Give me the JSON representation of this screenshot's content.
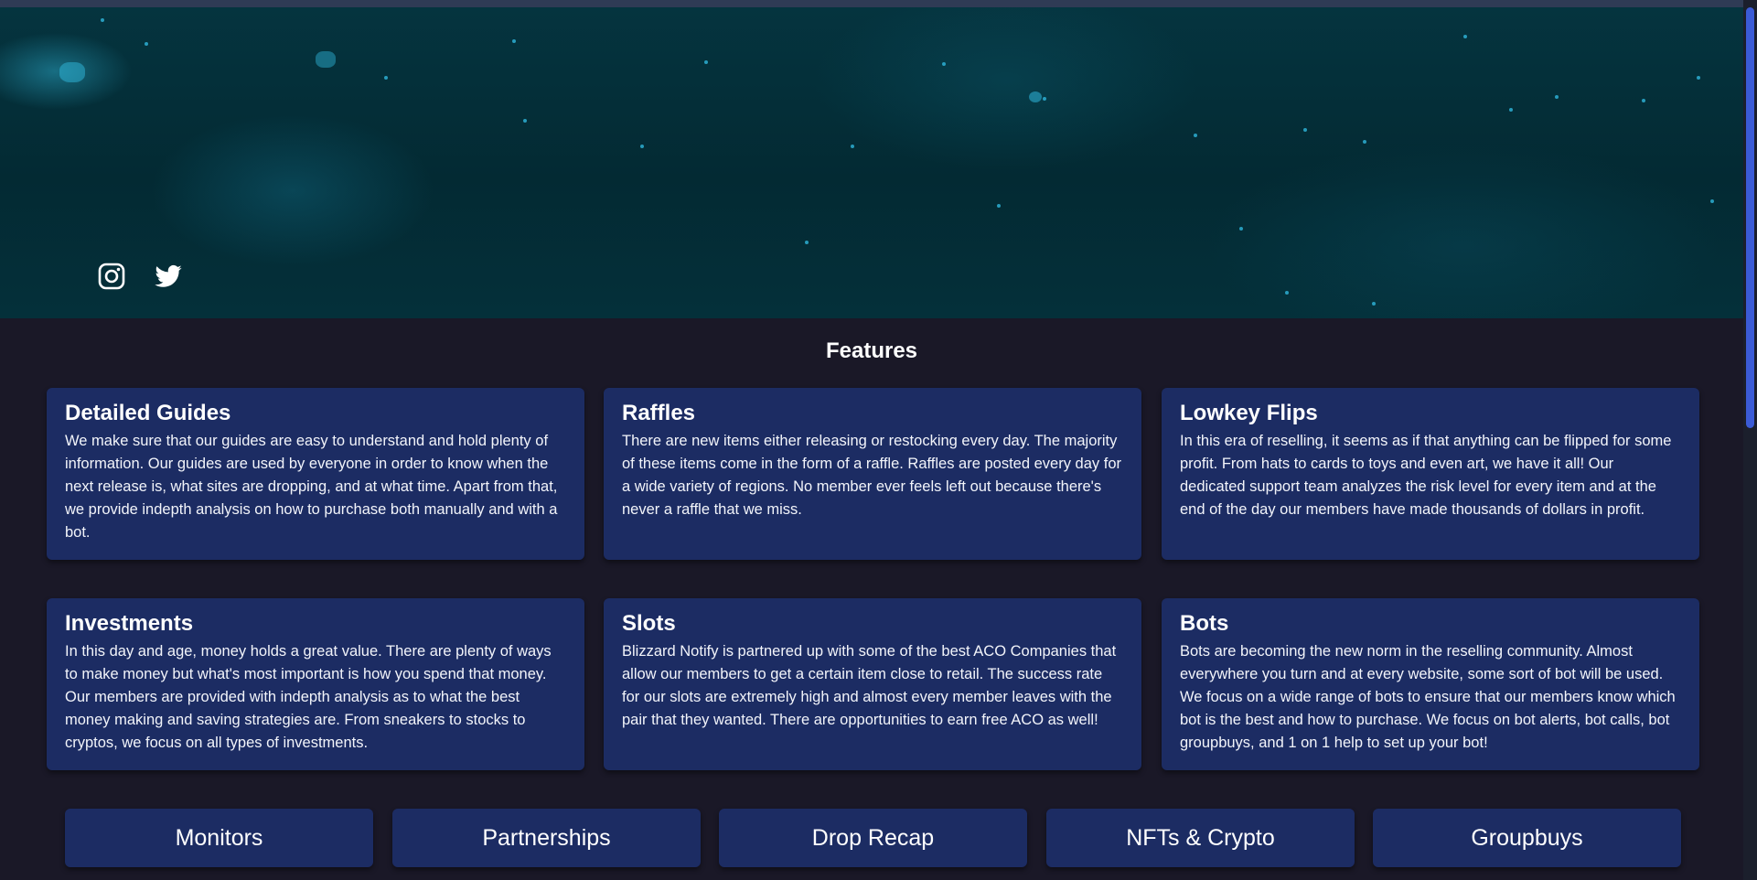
{
  "social": {
    "instagram_icon": "instagram-icon",
    "twitter_icon": "twitter-icon"
  },
  "features": {
    "title": "Features",
    "cards": [
      {
        "title": "Detailed Guides",
        "text": "We make sure that our guides are easy to understand and hold plenty of information. Our guides are used by everyone in order to know when the next release is, what sites are dropping, and at what time. Apart from that, we provide indepth analysis on how to purchase both manually and with a bot."
      },
      {
        "title": "Raffles",
        "text": "There are new items either releasing or restocking every day. The majority of these items come in the form of a raffle. Raffles are posted every day for a wide variety of regions. No member ever feels left out because there's never a raffle that we miss."
      },
      {
        "title": "Lowkey Flips",
        "text": "In this era of reselling, it seems as if that anything can be flipped for some profit. From hats to cards to toys and even art, we have it all! Our dedicated support team analyzes the risk level for every item and at the end of the day our members have made thousands of dollars in profit."
      },
      {
        "title": "Investments",
        "text": "In this day and age, money holds a great value. There are plenty of ways to make money but what's most important is how you spend that money. Our members are provided with indepth analysis as to what the best money making and saving strategies are. From sneakers to stocks to cryptos, we focus on all types of investments."
      },
      {
        "title": "Slots",
        "text": "Blizzard Notify is partnered up with some of the best ACO Companies that allow our members to get a certain item close to retail. The success rate for our slots are extremely high and almost every member leaves with the pair that they wanted. There are opportunities to earn free ACO as well!"
      },
      {
        "title": "Bots",
        "text": "Bots are becoming the new norm in the reselling community. Almost everywhere you turn and at every website, some sort of bot will be used. We focus on a wide range of bots to ensure that our members know which bot is the best and how to purchase. We focus on bot alerts, bot calls, bot groupbuys, and 1 on 1 help to set up your bot!"
      }
    ]
  },
  "buttons": [
    "Monitors",
    "Partnerships",
    "Drop Recap",
    "NFTs & Crypto",
    "Groupbuys"
  ],
  "colors": {
    "page_bg": "#1a1827",
    "card_bg": "#1c2c63",
    "scroll_thumb": "#3b5bd6"
  }
}
